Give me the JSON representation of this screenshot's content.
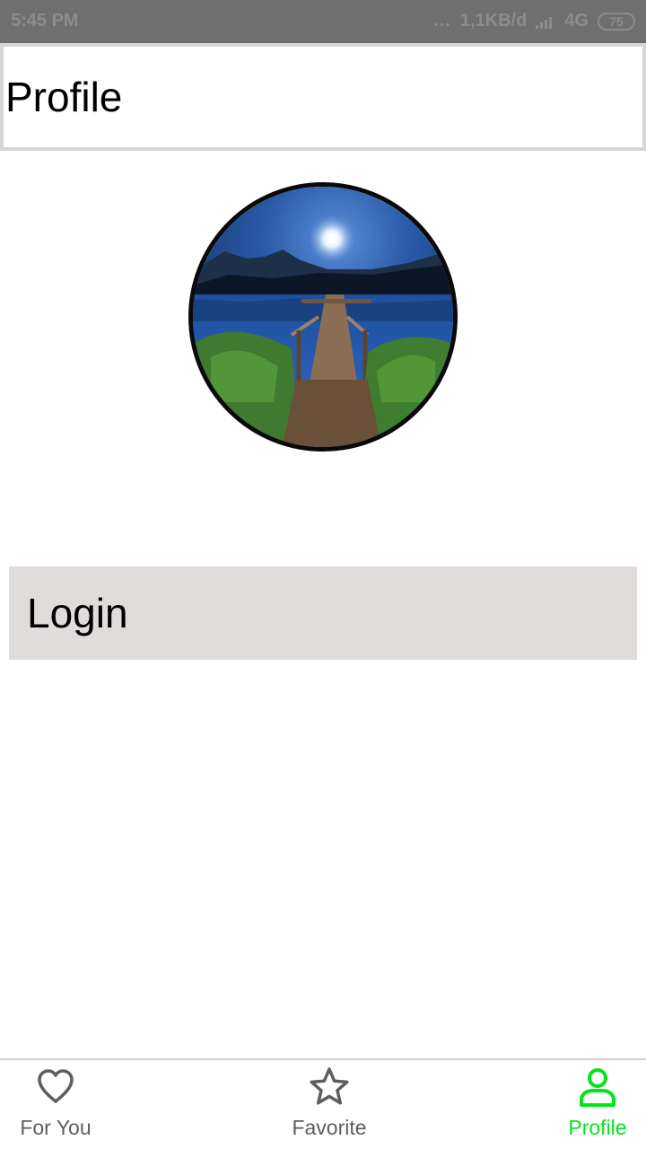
{
  "status_bar": {
    "time": "5:45 PM",
    "dots": "...",
    "network_speed": "1,1KB/d",
    "network_type": "4G",
    "battery": "75"
  },
  "header": {
    "title": "Profile"
  },
  "avatar": {
    "icon": "profile-photo-lake-pier"
  },
  "login": {
    "label": "Login"
  },
  "bottom_nav": {
    "items": [
      {
        "label": "For You",
        "icon": "heart-icon",
        "active": false
      },
      {
        "label": "Favorite",
        "icon": "star-icon",
        "active": false
      },
      {
        "label": "Profile",
        "icon": "person-icon",
        "active": true
      }
    ]
  },
  "colors": {
    "active": "#00e61a",
    "inactive": "#5e5e5e",
    "status_bar": "#6f6f6f",
    "login_background": "#e0dcdb"
  }
}
